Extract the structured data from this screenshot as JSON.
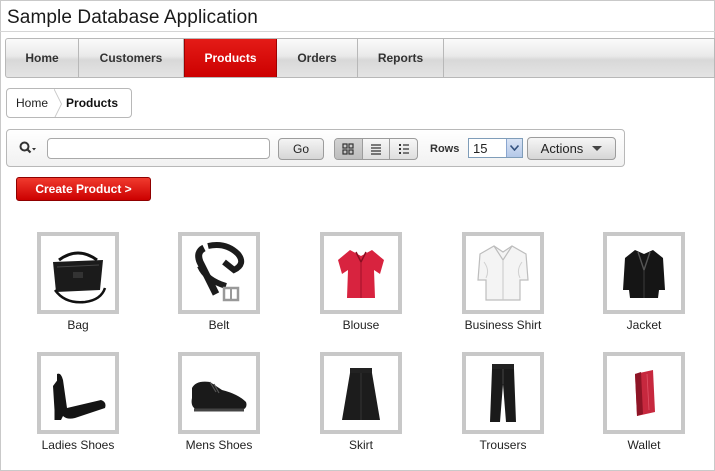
{
  "app": {
    "title": "Sample Database Application"
  },
  "tabs": [
    {
      "label": "Home",
      "active": false
    },
    {
      "label": "Customers",
      "active": false
    },
    {
      "label": "Products",
      "active": true
    },
    {
      "label": "Orders",
      "active": false
    },
    {
      "label": "Reports",
      "active": false
    }
  ],
  "breadcrumb": {
    "home": "Home",
    "current": "Products"
  },
  "search": {
    "value": "",
    "placeholder": "",
    "go_label": "Go",
    "rows_label": "Rows",
    "rows_value": "15",
    "actions_label": "Actions",
    "active_view": "icons"
  },
  "create_button": {
    "label": "Create Product >"
  },
  "products": [
    {
      "name": "Bag",
      "icon": "bag-icon"
    },
    {
      "name": "Belt",
      "icon": "belt-icon"
    },
    {
      "name": "Blouse",
      "icon": "blouse-icon"
    },
    {
      "name": "Business Shirt",
      "icon": "shirt-icon"
    },
    {
      "name": "Jacket",
      "icon": "jacket-icon"
    },
    {
      "name": "Ladies Shoes",
      "icon": "ladies-shoes-icon"
    },
    {
      "name": "Mens Shoes",
      "icon": "mens-shoes-icon"
    },
    {
      "name": "Skirt",
      "icon": "skirt-icon"
    },
    {
      "name": "Trousers",
      "icon": "trousers-icon"
    },
    {
      "name": "Wallet",
      "icon": "wallet-icon"
    }
  ],
  "colors": {
    "accent": "#cc0000",
    "thumb_border": "#c8c8c8",
    "tab_bar": "#e2e2e2"
  }
}
